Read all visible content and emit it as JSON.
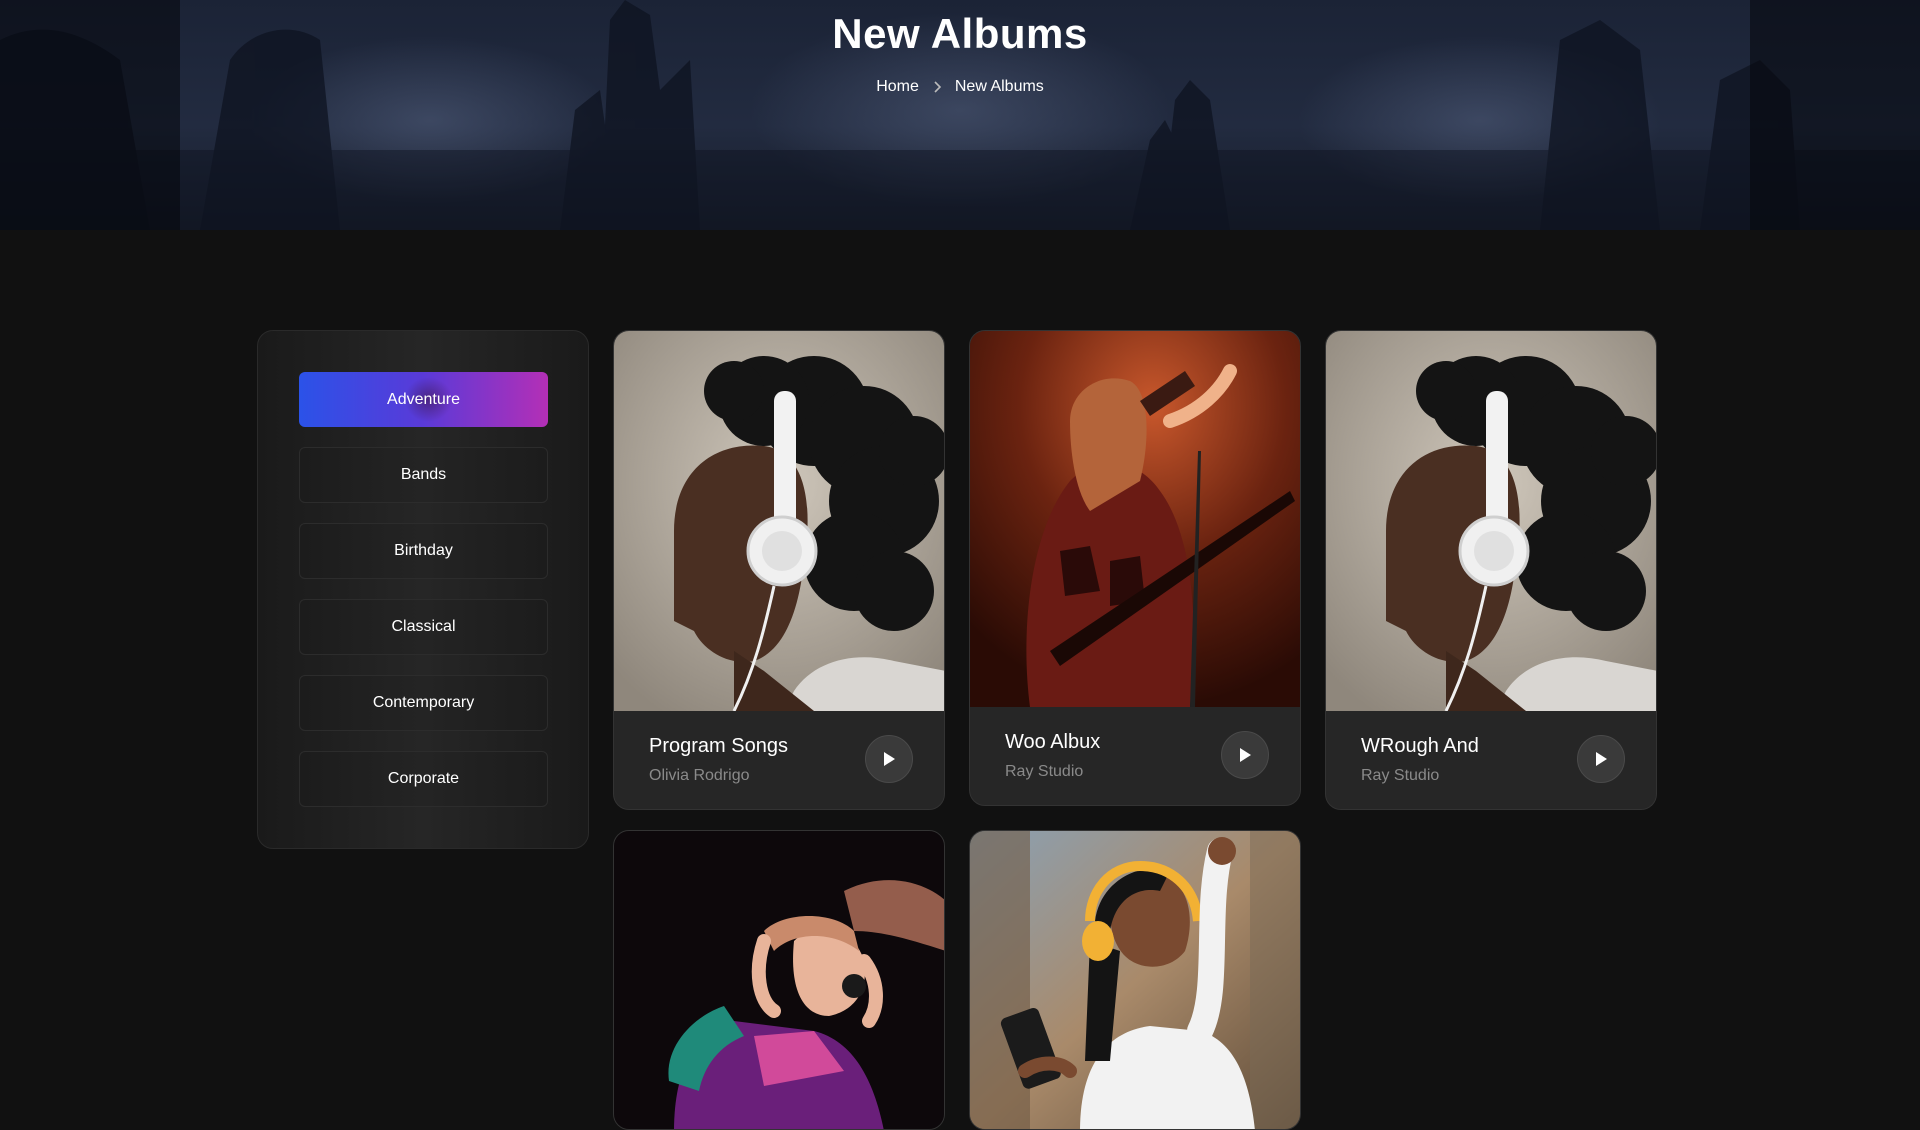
{
  "hero": {
    "title": "New Albums",
    "breadcrumb": {
      "home": "Home",
      "current": "New Albums"
    }
  },
  "sidebar": {
    "categories": [
      {
        "label": "Adventure",
        "active": true
      },
      {
        "label": "Bands",
        "active": false
      },
      {
        "label": "Birthday",
        "active": false
      },
      {
        "label": "Classical",
        "active": false
      },
      {
        "label": "Contemporary",
        "active": false
      },
      {
        "label": "Corporate",
        "active": false
      }
    ]
  },
  "albums": [
    {
      "title": "Program Songs",
      "artist": "Olivia Rodrigo",
      "art": "woman-with-white-headphones"
    },
    {
      "title": "Woo Albux",
      "artist": "Ray Studio",
      "art": "singer-with-guitar-red-light"
    },
    {
      "title": "WRough And",
      "artist": "Ray Studio",
      "art": "woman-with-white-headphones"
    },
    {
      "title": "",
      "artist": "",
      "art": "woman-dancing-with-headphones"
    },
    {
      "title": "",
      "artist": "",
      "art": "woman-with-yellow-headphones-and-phone"
    }
  ],
  "icons": {
    "breadcrumb_separator": "chevron-right-icon",
    "play": "play-icon"
  },
  "colors": {
    "page_bg": "#111111",
    "card_bg": "#262626",
    "accent_start": "#2b52e8",
    "accent_end": "#b42fb6",
    "muted_text": "#8a8a8a"
  }
}
